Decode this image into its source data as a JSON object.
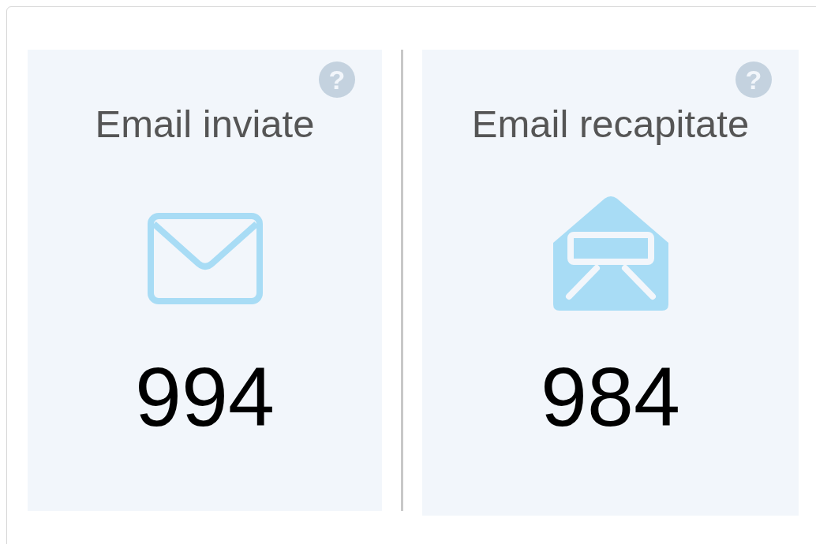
{
  "cards": [
    {
      "kind": "sent",
      "title": "Email inviate",
      "value": "994",
      "help": "?"
    },
    {
      "kind": "opened",
      "title": "Email recapitate",
      "value": "984",
      "help": "?"
    }
  ]
}
